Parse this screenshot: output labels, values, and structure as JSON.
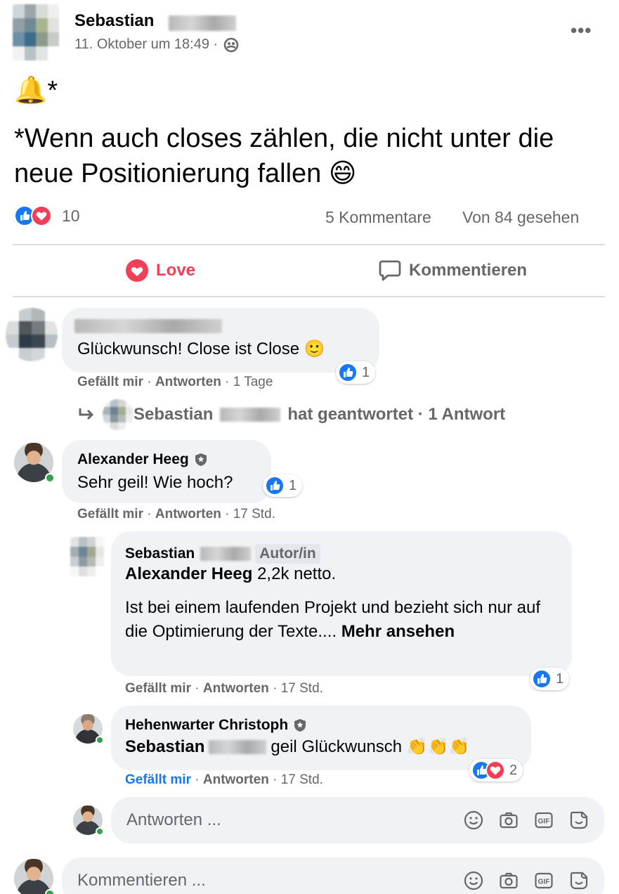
{
  "post": {
    "author_first": "Sebastian",
    "timestamp": "11. Oktober um 18:49 ·",
    "menu_icon": "more-icon",
    "emoji_line": "🔔*",
    "text": "*Wenn auch closes zählen, die nicht unter die neue Positionierung fallen 😄",
    "reaction_count": "10",
    "comments_count": "5 Kommentare",
    "views": "Von 84 gesehen"
  },
  "actions": {
    "love": "Love",
    "comment": "Kommentieren"
  },
  "comments": [
    {
      "text": "Glückwunsch! Close ist Close 🙂",
      "reactions": "1",
      "like": "Gefällt mir",
      "reply": "Antworten",
      "time": "· 1 Tage",
      "replies_author": "Sebastian",
      "replies_text": "hat geantwortet · 1 Antwort"
    },
    {
      "author": "Alexander Heeg",
      "text": "Sehr geil! Wie hoch?",
      "reactions": "1",
      "like": "Gefällt mir",
      "reply": "Antworten",
      "time": "· 17 Std."
    }
  ],
  "replies": [
    {
      "author": "Sebastian",
      "badge": "Autor/in",
      "mention": "Alexander Heeg",
      "text1": "2,2k netto.",
      "text2": "Ist bei einem laufenden Projekt und bezieht sich nur auf die Optimierung der Texte....",
      "more": "Mehr ansehen",
      "reactions": "1",
      "like": "Gefällt mir",
      "reply": "Antworten",
      "time": "· 17 Std."
    },
    {
      "author": "Hehenwarter Christoph",
      "mention": "Sebastian",
      "text": "geil Glückwunsch 👏👏👏",
      "reactions": "2",
      "like": "Gefällt mir",
      "reply": "Antworten",
      "time": "· 17 Std."
    }
  ],
  "reply_input": {
    "placeholder": "Antworten ..."
  },
  "comment_input": {
    "placeholder": "Kommentieren ..."
  },
  "colors": {
    "like": "#1877f2",
    "love": "#f33e58",
    "online": "#31a24c",
    "bubble": "#f0f2f5"
  }
}
